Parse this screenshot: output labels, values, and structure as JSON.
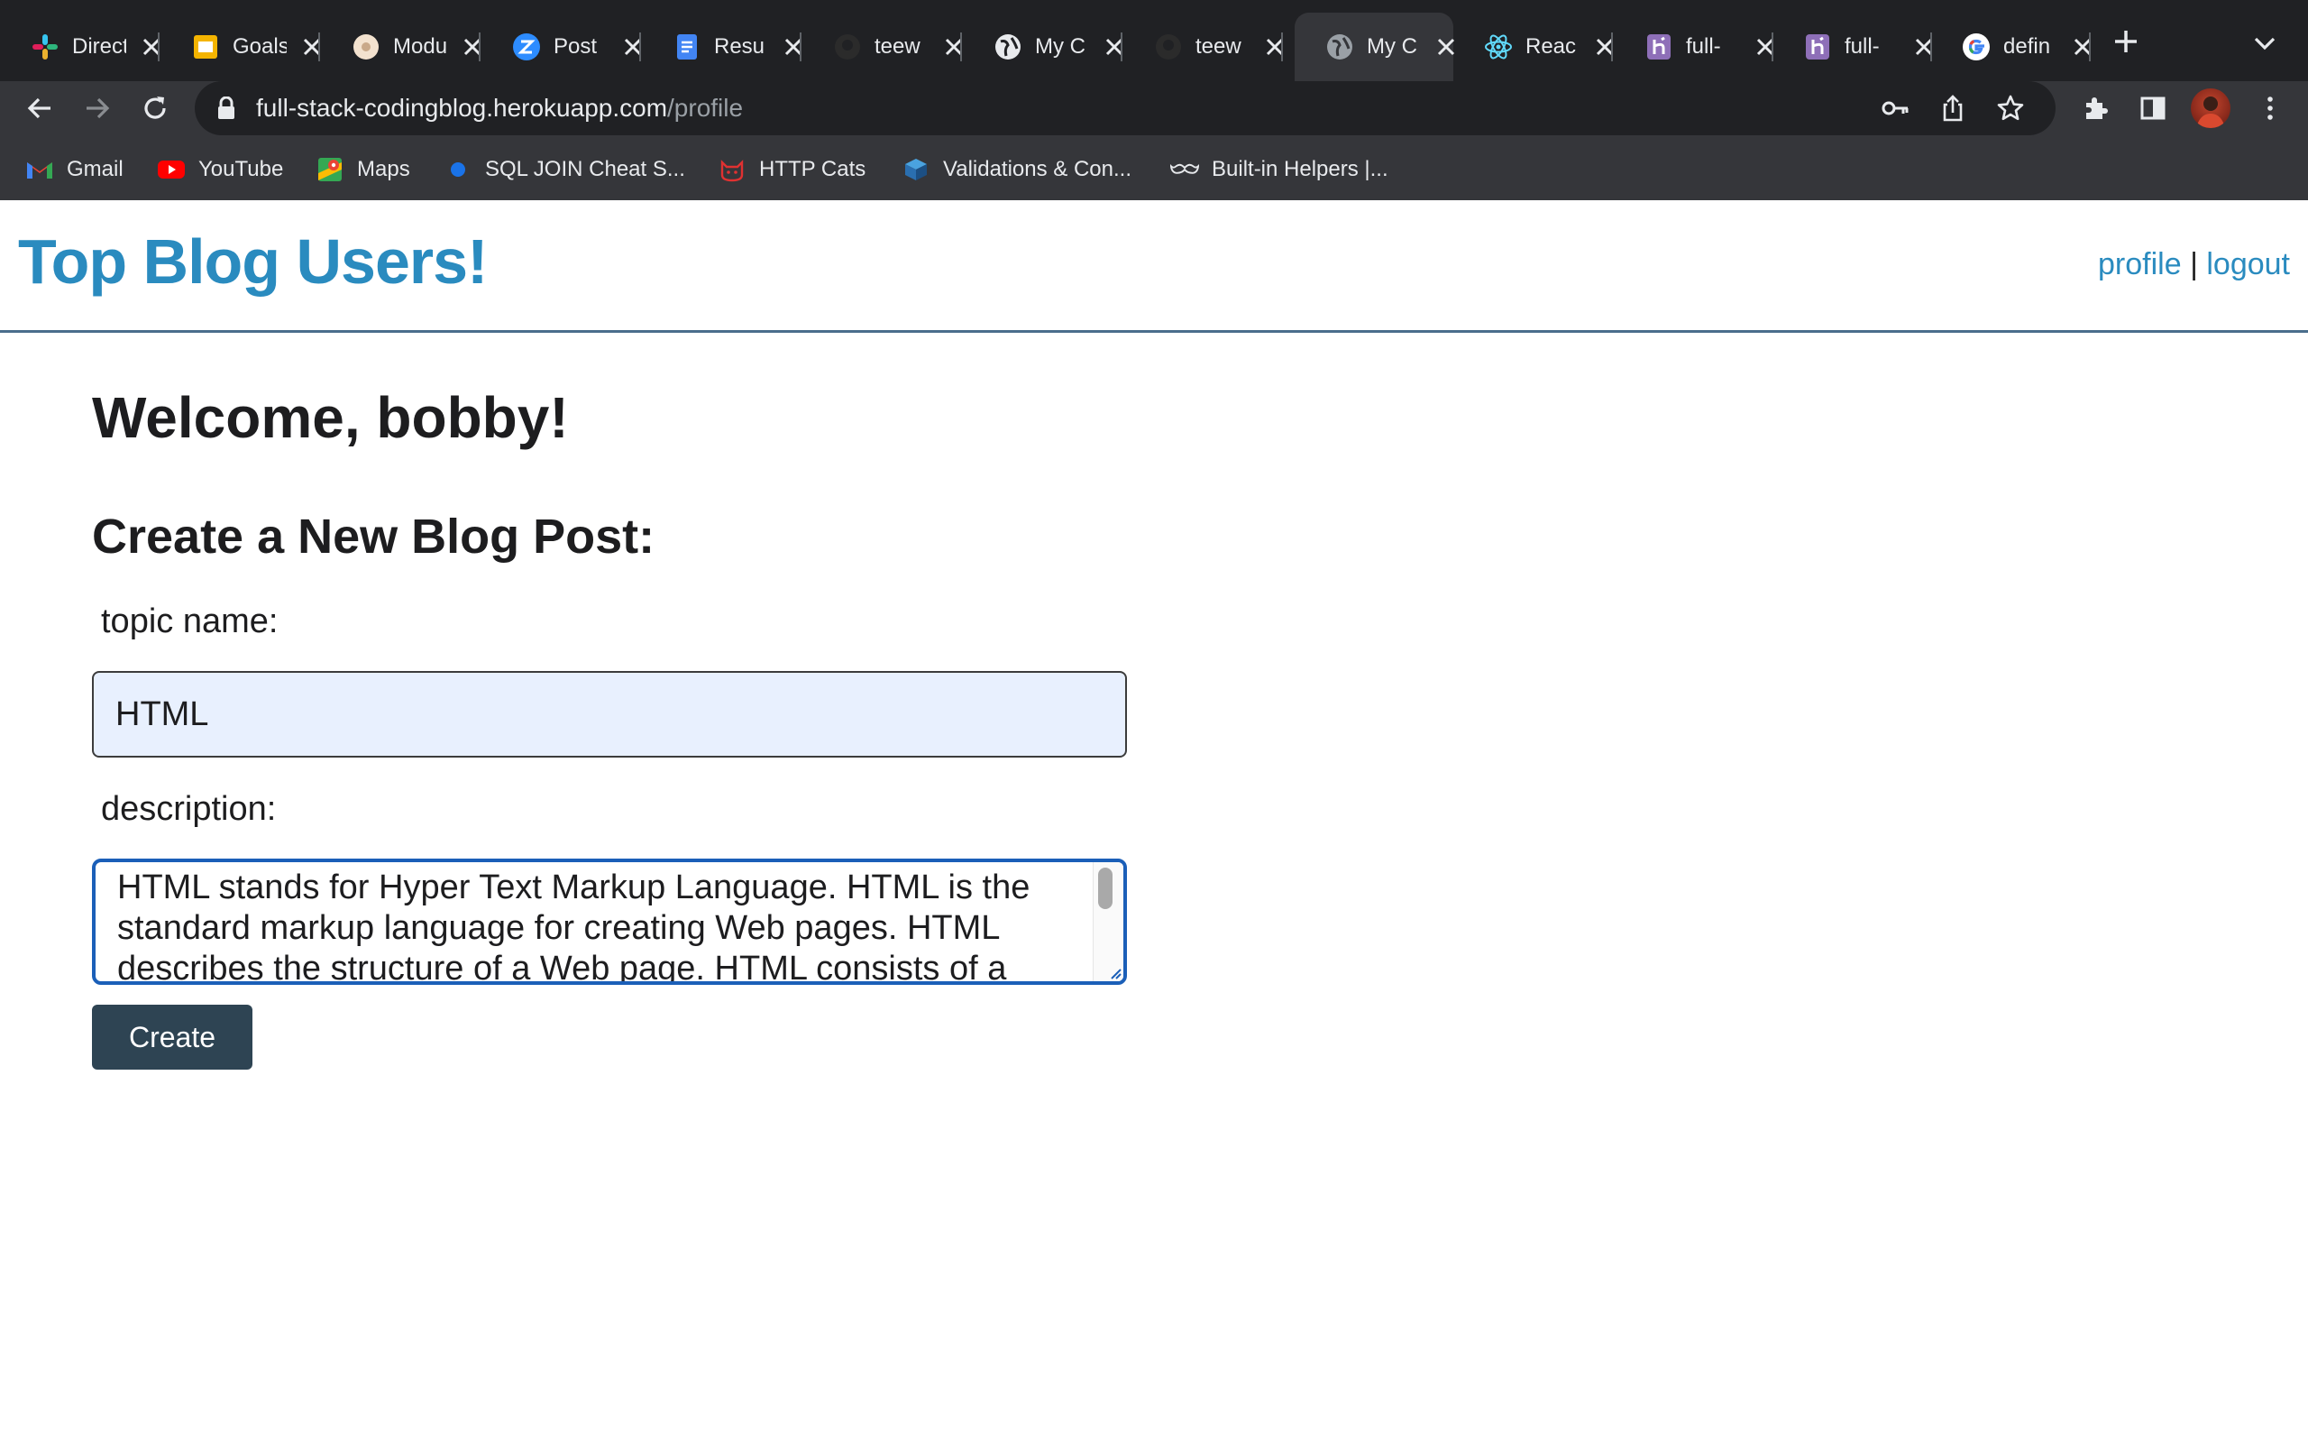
{
  "browser": {
    "tabs": [
      {
        "title": "Direct",
        "icon": "slack-icon"
      },
      {
        "title": "Goals",
        "icon": "slides-icon"
      },
      {
        "title": "Modu",
        "icon": "bagel-icon"
      },
      {
        "title": "Post",
        "icon": "zoom-icon"
      },
      {
        "title": "Resu",
        "icon": "docs-icon"
      },
      {
        "title": "teew",
        "icon": "github-icon"
      },
      {
        "title": "My C",
        "icon": "globe-icon"
      },
      {
        "title": "teew",
        "icon": "github-icon"
      },
      {
        "title": "My C",
        "icon": "globe-icon",
        "active": true
      },
      {
        "title": "Reac",
        "icon": "react-icon"
      },
      {
        "title": "full-",
        "icon": "heroku-icon"
      },
      {
        "title": "full-",
        "icon": "heroku-icon"
      },
      {
        "title": "defin",
        "icon": "google-icon"
      }
    ],
    "url_host": "full-stack-codingblog.herokuapp.com",
    "url_path": "/profile",
    "bookmarks": [
      {
        "label": "Gmail",
        "icon": "gmail-icon"
      },
      {
        "label": "YouTube",
        "icon": "youtube-icon"
      },
      {
        "label": "Maps",
        "icon": "maps-icon"
      },
      {
        "label": "SQL JOIN Cheat S...",
        "icon": "dot-icon"
      },
      {
        "label": "HTTP Cats",
        "icon": "cat-icon"
      },
      {
        "label": "Validations & Con...",
        "icon": "rails-guides-icon"
      },
      {
        "label": "Built-in Helpers |...",
        "icon": "mustache-icon"
      }
    ]
  },
  "site": {
    "title": "Top Blog Users!",
    "nav_profile": "profile",
    "nav_separator": "|",
    "nav_logout": "logout"
  },
  "main": {
    "welcome": "Welcome, bobby!",
    "form_heading": "Create a New Blog Post:",
    "topic_label": "topic name:",
    "topic_value": "HTML",
    "description_label": "description:",
    "description_value": "HTML stands for Hyper Text Markup Language. HTML is the standard markup language for creating Web pages. HTML describes the structure of a Web page. HTML consists of a",
    "create_button": "Create"
  },
  "colors": {
    "accent": "#2a8bbf",
    "button_bg": "#2e4453",
    "focus_border": "#1b5fb8",
    "autofill_bg": "#e8f0fe"
  }
}
